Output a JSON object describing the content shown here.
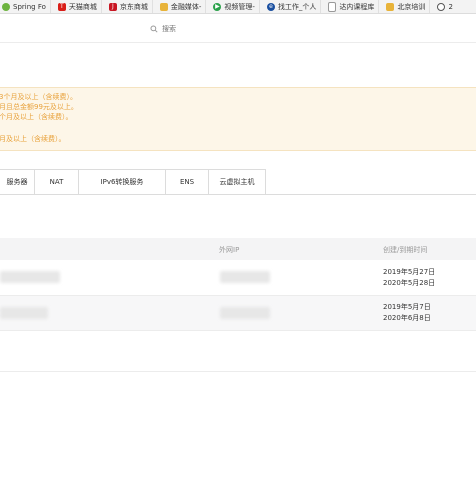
{
  "bookmarks": [
    {
      "label": "Spring Fo",
      "icon": "spring-icon",
      "color": "#6db33f"
    },
    {
      "label": "天猫商城",
      "icon": "tmall-icon",
      "color": "#d91e18"
    },
    {
      "label": "京东商城",
      "icon": "jd-icon",
      "color": "#c81623"
    },
    {
      "label": "金融媒体-",
      "icon": "folder-icon",
      "color": "#e8b339"
    },
    {
      "label": "视频管理-",
      "icon": "video-icon",
      "color": "#2aa14a"
    },
    {
      "label": "找工作_个人",
      "icon": "job-icon",
      "color": "#1a4fa0"
    },
    {
      "label": "达内课程库",
      "icon": "page-icon",
      "color": "#888888"
    },
    {
      "label": "北京培训",
      "icon": "folder-icon",
      "color": "#e8b339"
    },
    {
      "label": "2",
      "icon": "clock-icon",
      "color": "#555555"
    }
  ],
  "search": {
    "placeholder": "搜索"
  },
  "notice": {
    "lines": [
      "3个月及以上（含续费）。",
      "月且总金额99元及以上。",
      "个月及以上（含续费）。",
      "",
      "月及以上（含续费）。"
    ],
    "color": "#e8a13a"
  },
  "tabs": [
    "服务器",
    "NAT",
    "IPv6转换服务",
    "ENS",
    "云虚拟主机"
  ],
  "table": {
    "columns": {
      "left": "",
      "public_ip": "外网IP",
      "created_expire": "创建/到期时间"
    },
    "rows": [
      {
        "created": "2019年5月27日",
        "expire": "2020年5月28日"
      },
      {
        "created": "2019年5月7日",
        "expire": "2020年6月8日"
      }
    ]
  }
}
